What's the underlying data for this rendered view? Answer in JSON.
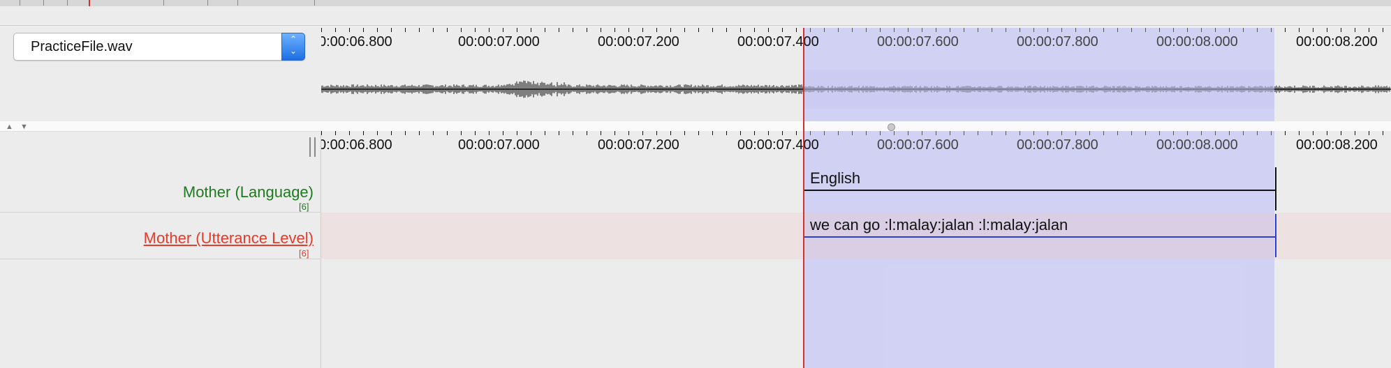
{
  "media_player": {
    "file_select": {
      "value": "PracticeFile.wav"
    }
  },
  "timeline": {
    "tick_labels": [
      "0:00:06.800",
      "00:00:07.000",
      "00:00:07.200",
      "00:00:07.400",
      "00:00:07.600",
      "00:00:07.800",
      "00:00:08.000",
      "00:00:08.200"
    ]
  },
  "tiers": [
    {
      "label": "Mother (Language)",
      "count": "[6]",
      "color": "#1f7a1f",
      "annotation": "English",
      "line_color": "#111111"
    },
    {
      "label": "Mother (Utterance Level)",
      "count": "[6]",
      "color": "#e63a2a",
      "annotation": "we can go :l:malay:jalan :l:malay:jalan",
      "line_color": "#2a3fd0"
    }
  ],
  "colors": {
    "cursor": "#d03030",
    "selection": "#aaaaff"
  }
}
